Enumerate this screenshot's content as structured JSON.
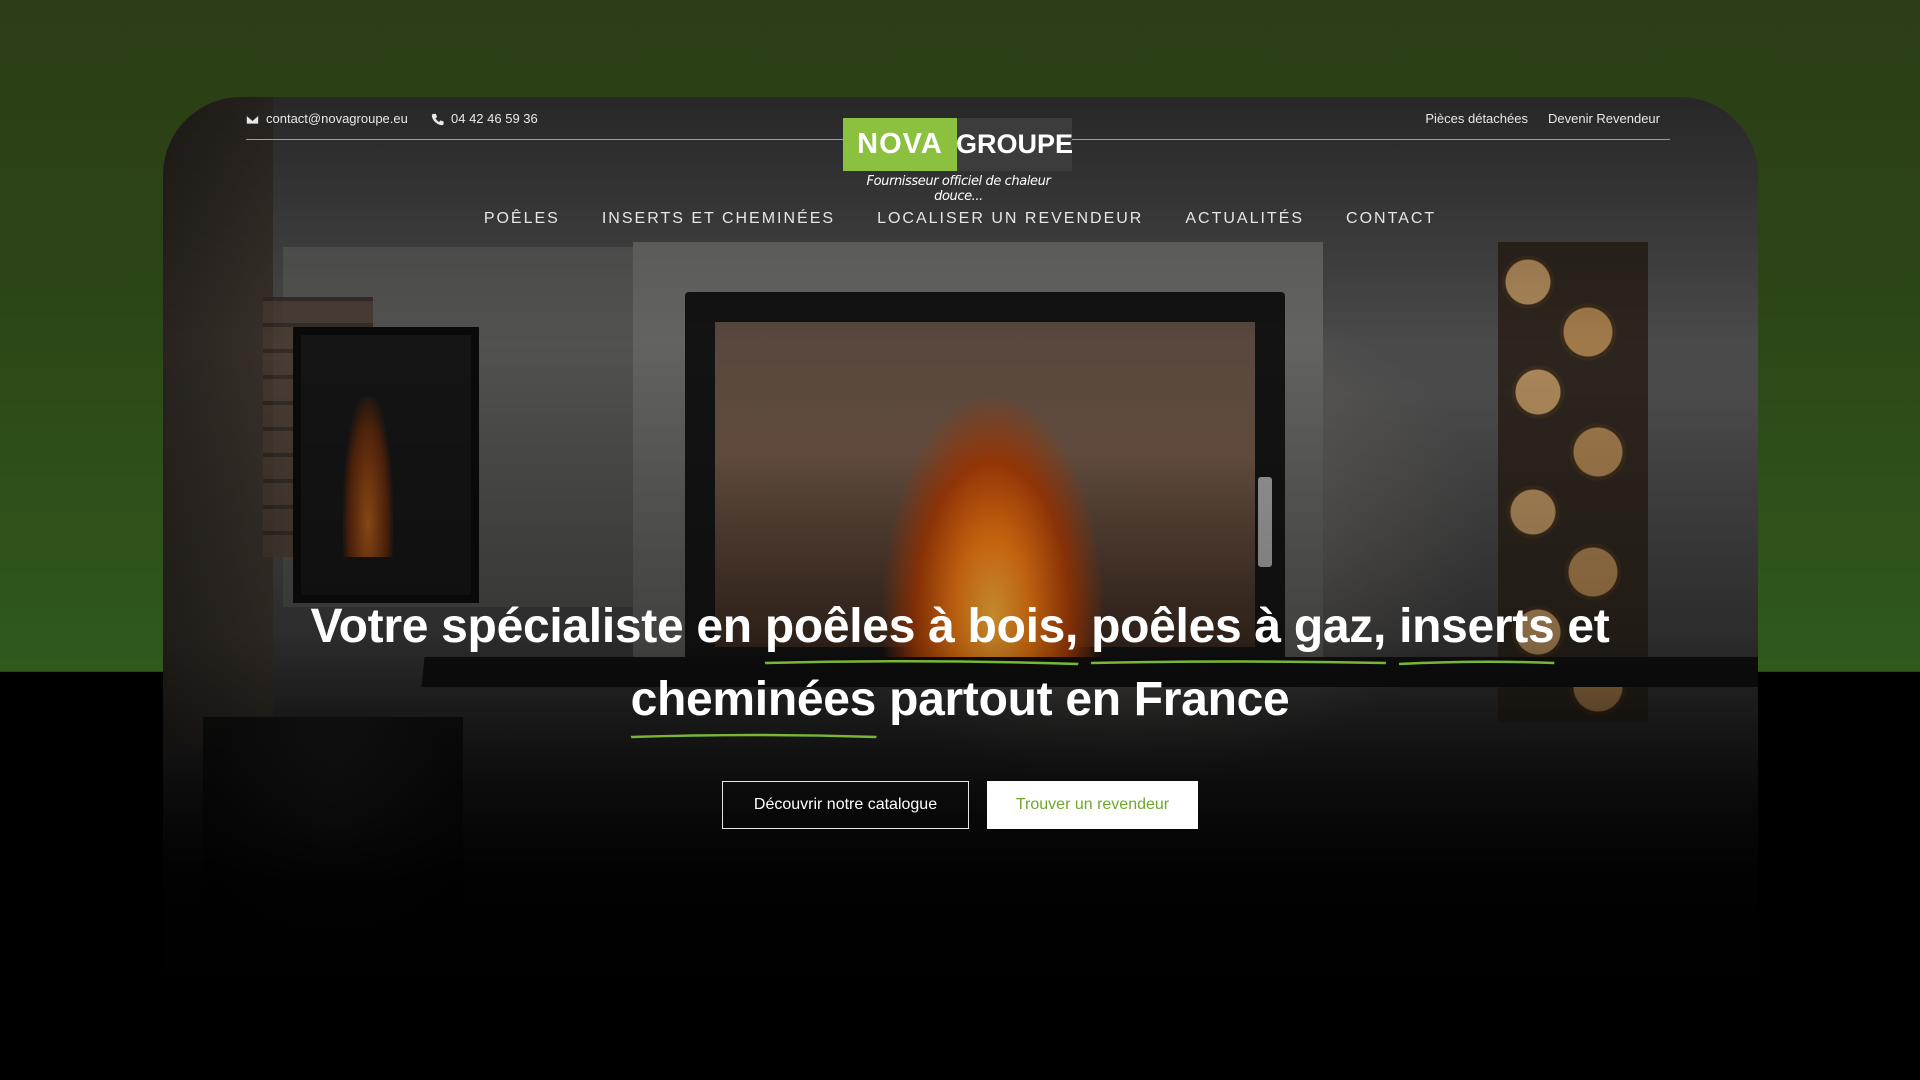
{
  "topbar": {
    "email": "contact@novagroupe.eu",
    "phone": "04 42 46 59 36",
    "links": [
      "Pièces détachées",
      "Devenir Revendeur"
    ]
  },
  "logo": {
    "nova": "NOVA",
    "groupe": "GROUPE",
    "tagline": "Fournisseur officiel de chaleur douce..."
  },
  "nav": [
    "POÊLES",
    "INSERTS ET CHEMINÉES",
    "LOCALISER UN REVENDEUR",
    "ACTUALITÉS",
    "CONTACT"
  ],
  "hero": {
    "t1": "Votre spécialiste en ",
    "h1": "poêles à bois,",
    "t2": " ",
    "h2": "poêles à gaz,",
    "t3": " ",
    "h3": "inserts",
    "t4": " et ",
    "h4": "cheminées",
    "t5": " partout en France"
  },
  "buttons": {
    "catalogue": "Découvrir notre catalogue",
    "revendeur": "Trouver un revendeur"
  },
  "colors": {
    "accent": "#8bc13f",
    "underline": "#78b734",
    "bg_top": "#2c4417"
  },
  "icons": [
    "envelope-icon",
    "phone-icon"
  ]
}
